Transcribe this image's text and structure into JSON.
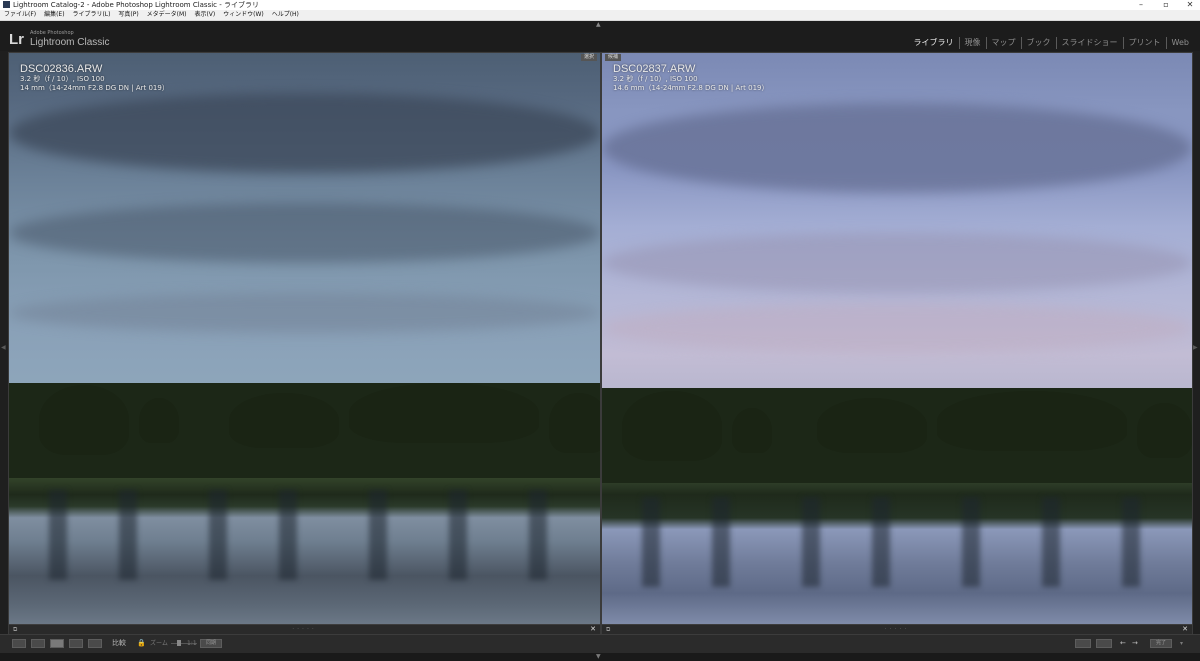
{
  "window": {
    "title": "Lightroom Catalog-2 - Adobe Photoshop Lightroom Classic - ライブラリ",
    "controls": [
      "–",
      "▫",
      "✕"
    ]
  },
  "menu": [
    "ファイル(F)",
    "編集(E)",
    "ライブラリ(L)",
    "写真(P)",
    "メタデータ(M)",
    "表示(V)",
    "ウィンドウ(W)",
    "ヘルプ(H)"
  ],
  "identity": {
    "logo": "Lr",
    "subtitle_small": "Adobe Photoshop",
    "subtitle": "Lightroom Classic"
  },
  "modules": [
    {
      "label": "ライブラリ",
      "active": true
    },
    {
      "label": "現像",
      "active": false
    },
    {
      "label": "マップ",
      "active": false
    },
    {
      "label": "ブック",
      "active": false
    },
    {
      "label": "スライドショー",
      "active": false
    },
    {
      "label": "プリント",
      "active": false
    },
    {
      "label": "Web",
      "active": false
    }
  ],
  "compare": {
    "left": {
      "tag": "選択",
      "filename": "DSC02836.ARW",
      "exposure": "3.2 秒（f / 10）, ISO 100",
      "lens": "14 mm（14-24mm F2.8 DG DN | Art 019）"
    },
    "right": {
      "tag": "候補",
      "filename": "DSC02837.ARW",
      "exposure": "3.2 秒（f / 10）, ISO 100",
      "lens": "14.6 mm（14-24mm F2.8 DG DN | Art 019）"
    },
    "close_glyph": "✕"
  },
  "toolbar": {
    "compare_label": "比較",
    "zoom_label": "ズーム",
    "zoom_value": "1:1",
    "sync_label": "同期",
    "done_label": "完了"
  },
  "colors": {
    "background": "#1f1f1f",
    "active_module": "#ececec",
    "inactive_module": "#8e8e8e"
  }
}
